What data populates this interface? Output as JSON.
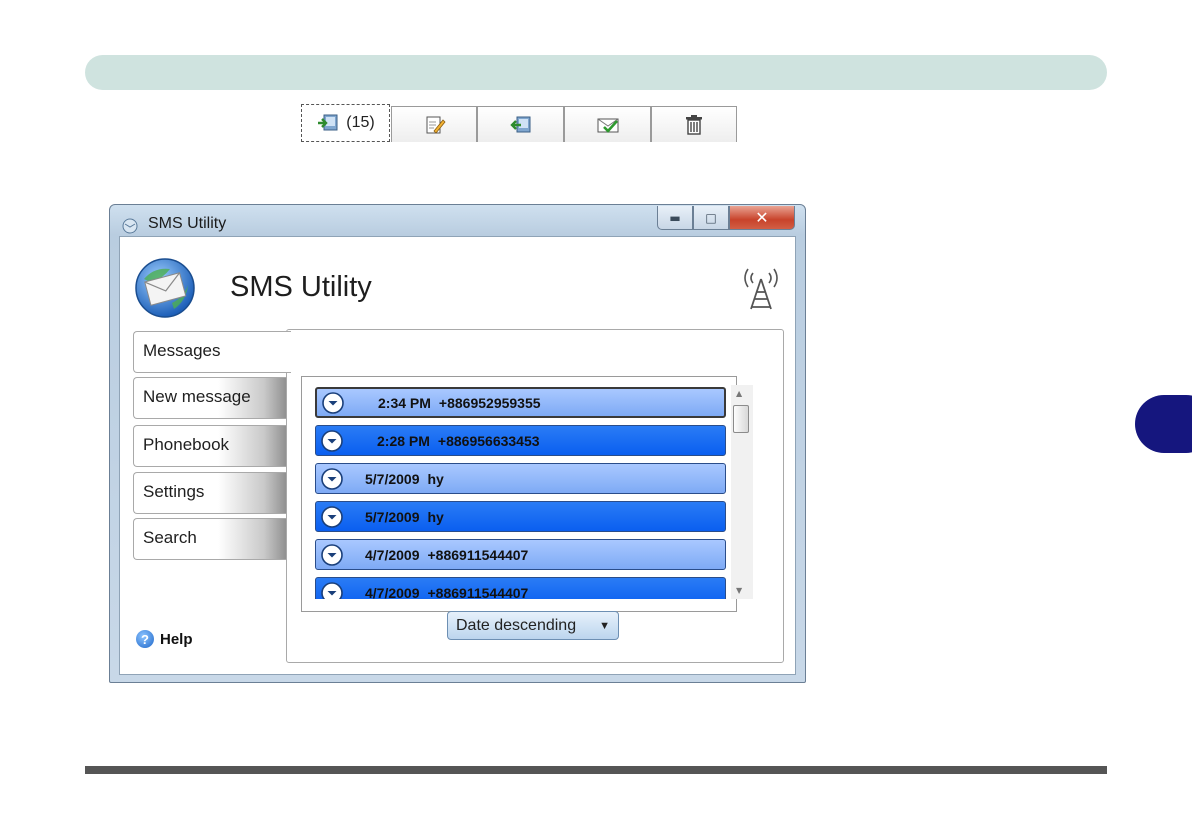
{
  "window": {
    "title": "SMS Utility"
  },
  "header": {
    "app_title": "SMS Utility",
    "signal_icon": "signal-tower-icon"
  },
  "nav": {
    "items": [
      {
        "label": "Messages",
        "active": true
      },
      {
        "label": "New message",
        "active": false
      },
      {
        "label": "Phonebook",
        "active": false
      },
      {
        "label": "Settings",
        "active": false
      },
      {
        "label": "Search",
        "active": false
      }
    ],
    "help_label": "Help"
  },
  "toolbar": {
    "tabs": [
      {
        "icon": "inbox-icon",
        "count": "(15)",
        "active": true
      },
      {
        "icon": "compose-icon"
      },
      {
        "icon": "outbox-icon"
      },
      {
        "icon": "sent-icon"
      },
      {
        "icon": "trash-icon"
      }
    ]
  },
  "messages": [
    {
      "time": "2:34 PM",
      "sender": "+886952959355",
      "style": "light",
      "selected": true
    },
    {
      "time": "2:28 PM",
      "sender": "+886956633453",
      "style": "dark",
      "selected": false
    },
    {
      "time": "5/7/2009",
      "sender": "hy",
      "style": "light",
      "selected": false
    },
    {
      "time": "5/7/2009",
      "sender": "hy",
      "style": "dark",
      "selected": false
    },
    {
      "time": "4/7/2009",
      "sender": "+886911544407",
      "style": "light",
      "selected": false
    },
    {
      "time": "4/7/2009",
      "sender": "+886911544407",
      "style": "dark",
      "selected": false
    }
  ],
  "sort": {
    "selected": "Date descending"
  },
  "colors": {
    "row_light": "#8fb6fa",
    "row_dark": "#1a6ef3",
    "accent_tab": "#15167e"
  }
}
